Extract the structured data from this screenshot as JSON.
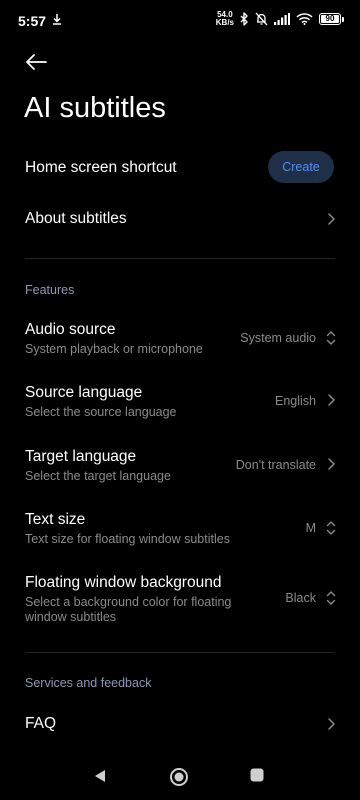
{
  "status": {
    "time": "5:57",
    "net_speed_value": "54.0",
    "net_speed_unit": "KB/s",
    "battery": "90"
  },
  "header": {
    "title": "AI subtitles"
  },
  "top_items": {
    "shortcut_title": "Home screen shortcut",
    "create_label": "Create",
    "about_title": "About subtitles"
  },
  "features": {
    "section_label": "Features",
    "items": [
      {
        "title": "Audio source",
        "subtitle": "System playback or microphone",
        "value": "System audio",
        "control": "updown-icon"
      },
      {
        "title": "Source language",
        "subtitle": "Select the source language",
        "value": "English",
        "control": "chevron-right-icon"
      },
      {
        "title": "Target language",
        "subtitle": "Select the target language",
        "value": "Don't translate",
        "control": "chevron-right-icon"
      },
      {
        "title": "Text size",
        "subtitle": "Text size for floating window subtitles",
        "value": "M",
        "control": "updown-icon"
      },
      {
        "title": "Floating window background",
        "subtitle_line1": "Select a background color for floating",
        "subtitle_line2": "window subtitles",
        "value": "Black",
        "control": "updown-icon"
      }
    ]
  },
  "services": {
    "section_label": "Services and feedback",
    "faq_title": "FAQ"
  },
  "colors": {
    "background": "#000000",
    "accent": "#4b8ff5",
    "button_bg": "#1f2f47",
    "section_label": "#8c97b5",
    "secondary_text": "#8a8a8a"
  }
}
